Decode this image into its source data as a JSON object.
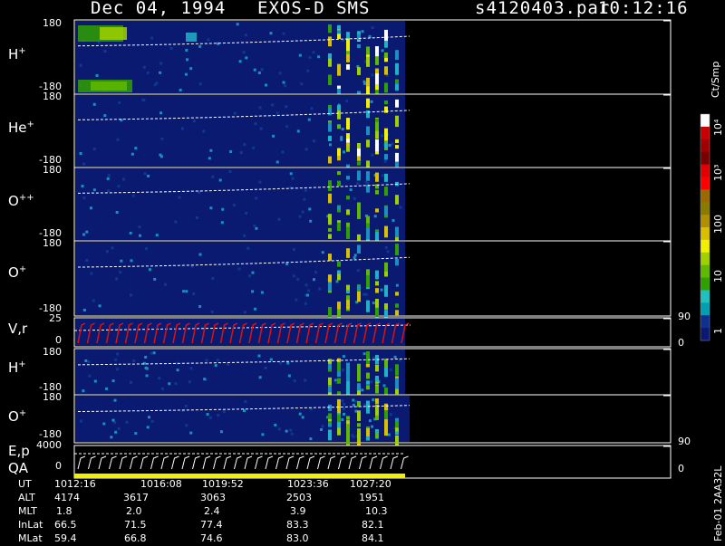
{
  "header": {
    "date": "Dec 04, 1994",
    "title": "EXOS-D SMS",
    "file": "s4120403.par",
    "time": "10:12:16"
  },
  "panels": [
    {
      "id": "h-plus",
      "label": "H",
      "sup": "+",
      "ytop": "180",
      "ybot": "-180"
    },
    {
      "id": "he-plus",
      "label": "He",
      "sup": "+",
      "ytop": "180",
      "ybot": "-180"
    },
    {
      "id": "o-plusplus",
      "label": "O",
      "sup": "++",
      "ytop": "180",
      "ybot": "-180"
    },
    {
      "id": "o-plus",
      "label": "O",
      "sup": "+",
      "ytop": "180",
      "ybot": "-180"
    },
    {
      "id": "vr",
      "label": "V,r",
      "sup": "",
      "ytop": "25",
      "ymid": "0",
      "rtop": "90",
      "rmid": "0"
    },
    {
      "id": "h-plus-2",
      "label": "H",
      "sup": "+",
      "ytop": "180",
      "ybot": "-180"
    },
    {
      "id": "o-plus-2",
      "label": "O",
      "sup": "+",
      "ytop": "180",
      "ybot": "-180"
    },
    {
      "id": "ep",
      "label": "E,p",
      "label2": "QA",
      "sup": "",
      "ytop": "4000",
      "ymid": "0",
      "rtop": "90",
      "rmid": "0"
    }
  ],
  "colorbar": {
    "units": "Ct/Smp",
    "ticks": [
      "10⁴",
      "10³",
      "100",
      "10",
      "1"
    ],
    "colors": [
      "#ffffff",
      "#c80000",
      "#a00000",
      "#780000",
      "#e00000",
      "#ff0000",
      "#9a6a00",
      "#8a7a00",
      "#b09000",
      "#d8c000",
      "#f0f000",
      "#a0d000",
      "#60b800",
      "#30a000",
      "#20c0c0",
      "#00a0b0",
      "#103090",
      "#0a1a70"
    ]
  },
  "chart_data": {
    "type": "heatmap",
    "title": "EXOS-D SMS",
    "x_ticks": [
      "1012:16",
      "1016:08",
      "1019:52",
      "1023:36",
      "1027:20"
    ],
    "panels": [
      "H+",
      "He+",
      "O++",
      "O+",
      "V,r",
      "H+",
      "O+",
      "E,p QA"
    ],
    "y_range_angle": [
      -180,
      180
    ],
    "vr_range": [
      0,
      25
    ],
    "ep_range": [
      0,
      4000
    ],
    "colorbar_range_ct_per_smp": [
      1,
      10000
    ],
    "colorbar_scale": "log"
  },
  "orbit_table": {
    "rows": [
      {
        "label": "UT",
        "values": [
          "1012:16",
          "1016:08",
          "1019:52",
          "1023:36",
          "1027:20"
        ]
      },
      {
        "label": "ALT",
        "values": [
          "4174",
          "3617",
          "3063",
          "2503",
          "1951"
        ]
      },
      {
        "label": "MLT",
        "values": [
          "1.8",
          "2.0",
          "2.4",
          "3.9",
          "10.3"
        ]
      },
      {
        "label": "InLat",
        "values": [
          "66.5",
          "71.5",
          "77.4",
          "83.3",
          "82.1"
        ]
      },
      {
        "label": "MLat",
        "values": [
          "59.4",
          "66.8",
          "74.6",
          "83.0",
          "84.1"
        ]
      }
    ]
  },
  "side_text": "Feb-01 2AA32L"
}
